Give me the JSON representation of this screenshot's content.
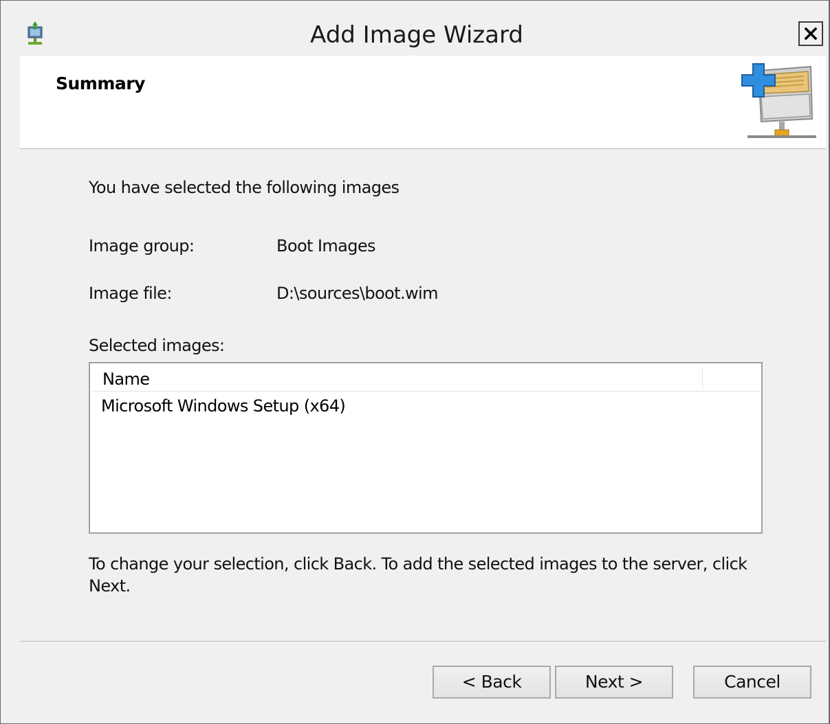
{
  "window": {
    "title": "Add Image Wizard"
  },
  "header": {
    "title": "Summary"
  },
  "content": {
    "intro": "You have selected the following images",
    "image_group_label": "Image group:",
    "image_group_value": "Boot Images",
    "image_file_label": "Image file:",
    "image_file_value": "D:\\sources\\boot.wim",
    "selected_images_label": "Selected images:",
    "list": {
      "columns": [
        "Name"
      ],
      "rows": [
        {
          "name": "Microsoft Windows Setup (x64)"
        }
      ]
    },
    "note": "To change your selection, click Back. To add the selected images to the server, click Next."
  },
  "buttons": {
    "back": "< Back",
    "next": "Next >",
    "cancel": "Cancel"
  },
  "icons": {
    "title": "wds-server-icon",
    "close": "close-icon",
    "wizard": "add-image-server-icon"
  },
  "colors": {
    "background": "#f0f0f0",
    "header": "#ffffff",
    "accent_blue": "#2f8fde",
    "accent_gold": "#e6a523"
  }
}
